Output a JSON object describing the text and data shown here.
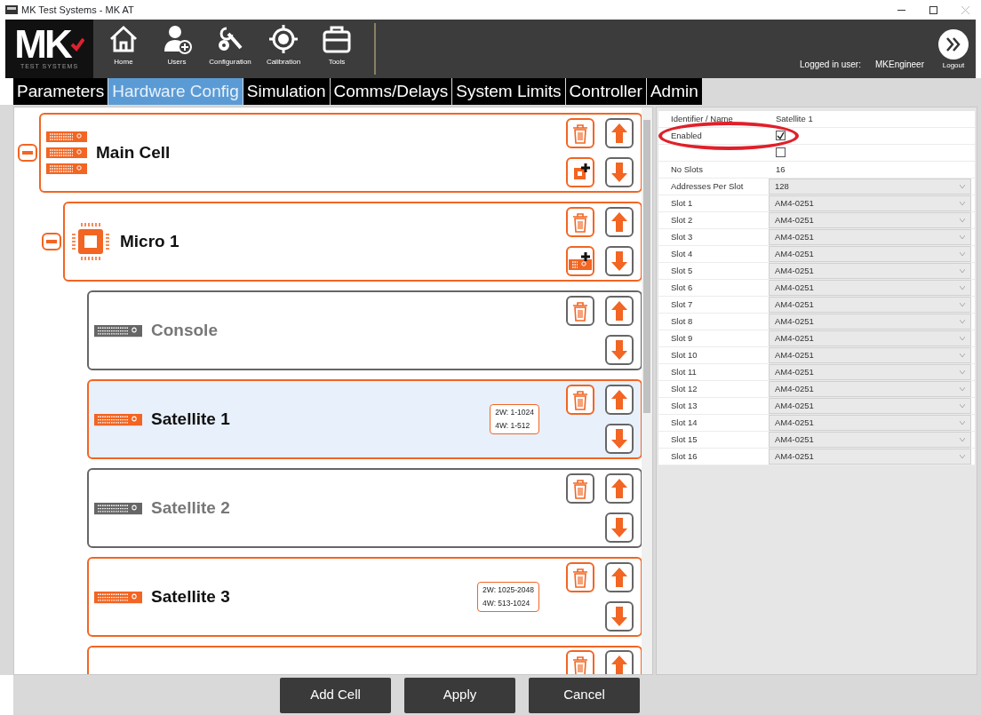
{
  "window": {
    "title": "MK Test Systems - MK AT"
  },
  "logo": {
    "letters": "MK",
    "tagline": "TEST SYSTEMS"
  },
  "toolbar": [
    {
      "label": "Home",
      "kind": "home"
    },
    {
      "label": "Users",
      "kind": "users"
    },
    {
      "label": "Configuration",
      "kind": "configuration"
    },
    {
      "label": "Calibration",
      "kind": "calibration"
    },
    {
      "label": "Tools",
      "kind": "tools"
    }
  ],
  "user": {
    "label": "Logged in user:",
    "name": "MKEngineer",
    "logout": "Logout"
  },
  "tabs": [
    {
      "label": "Parameters",
      "selected": false
    },
    {
      "label": "Hardware Config",
      "selected": true
    },
    {
      "label": "Simulation",
      "selected": false
    },
    {
      "label": "Comms/Delays",
      "selected": false
    },
    {
      "label": "System Limits",
      "selected": false
    },
    {
      "label": "Controller",
      "selected": false
    },
    {
      "label": "Admin",
      "selected": false
    }
  ],
  "tree": [
    {
      "name": "Main Cell",
      "kind": "cell",
      "enabled": true,
      "selected": false,
      "expanded": true,
      "children": [
        {
          "name": "Micro 1",
          "kind": "micro",
          "enabled": true,
          "selected": false,
          "expanded": true,
          "children": [
            {
              "name": "Console",
              "kind": "unit",
              "enabled": false,
              "selected": false
            },
            {
              "name": "Satellite 1",
              "kind": "unit",
              "enabled": true,
              "selected": true,
              "badge": [
                "2W: 1-1024",
                "4W: 1-512"
              ]
            },
            {
              "name": "Satellite 2",
              "kind": "unit",
              "enabled": false,
              "selected": false
            },
            {
              "name": "Satellite 3",
              "kind": "unit",
              "enabled": true,
              "selected": false,
              "badge": [
                "2W: 1025-2048",
                "4W: 513-1024"
              ]
            },
            {
              "enabled": true,
              "selected": false,
              "cut_off": true
            }
          ]
        }
      ]
    }
  ],
  "properties": [
    {
      "label": "Identifier / Name",
      "kind": "text",
      "value": "Satellite 1",
      "circled": false
    },
    {
      "label": "Enabled",
      "kind": "checkbox",
      "checked": true,
      "circled": true
    },
    {
      "kind": "checkbox",
      "checked": false,
      "circled": false
    },
    {
      "label": "No Slots",
      "kind": "text",
      "value": "16",
      "circled": false
    },
    {
      "label": "Addresses Per Slot",
      "kind": "dropdown",
      "value": "128",
      "circled": false
    },
    {
      "label": "Slot 1",
      "kind": "dropdown",
      "value": "AM4-0251",
      "circled": false
    },
    {
      "label": "Slot 2",
      "kind": "dropdown",
      "value": "AM4-0251",
      "circled": false
    },
    {
      "label": "Slot 3",
      "kind": "dropdown",
      "value": "AM4-0251",
      "circled": false
    },
    {
      "label": "Slot 4",
      "kind": "dropdown",
      "value": "AM4-0251",
      "circled": false
    },
    {
      "label": "Slot 5",
      "kind": "dropdown",
      "value": "AM4-0251",
      "circled": false
    },
    {
      "label": "Slot 6",
      "kind": "dropdown",
      "value": "AM4-0251",
      "circled": false
    },
    {
      "label": "Slot 7",
      "kind": "dropdown",
      "value": "AM4-0251",
      "circled": false
    },
    {
      "label": "Slot 8",
      "kind": "dropdown",
      "value": "AM4-0251",
      "circled": false
    },
    {
      "label": "Slot 9",
      "kind": "dropdown",
      "value": "AM4-0251",
      "circled": false
    },
    {
      "label": "Slot 10",
      "kind": "dropdown",
      "value": "AM4-0251",
      "circled": false
    },
    {
      "label": "Slot 11",
      "kind": "dropdown",
      "value": "AM4-0251",
      "circled": false
    },
    {
      "label": "Slot 12",
      "kind": "dropdown",
      "value": "AM4-0251",
      "circled": false
    },
    {
      "label": "Slot 13",
      "kind": "dropdown",
      "value": "AM4-0251",
      "circled": false
    },
    {
      "label": "Slot 14",
      "kind": "dropdown",
      "value": "AM4-0251",
      "circled": false
    },
    {
      "label": "Slot 15",
      "kind": "dropdown",
      "value": "AM4-0251",
      "circled": false
    },
    {
      "label": "Slot 16",
      "kind": "dropdown",
      "value": "AM4-0251",
      "circled": false
    }
  ],
  "buttons": [
    "Add Cell",
    "Apply",
    "Cancel"
  ]
}
